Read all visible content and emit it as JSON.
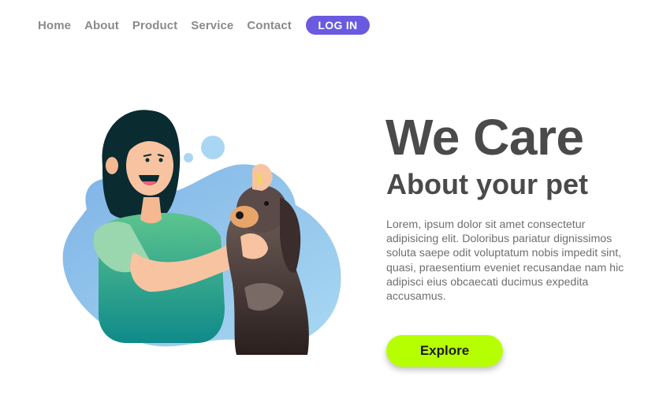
{
  "nav": {
    "items": [
      {
        "label": "Home"
      },
      {
        "label": "About"
      },
      {
        "label": "Product"
      },
      {
        "label": "Service"
      },
      {
        "label": "Contact"
      }
    ],
    "login_label": "LOG IN"
  },
  "hero": {
    "title": "We Care",
    "subtitle": "About your pet",
    "body": "Lorem, ipsum dolor sit amet consectetur adipisicing elit. Doloribus pariatur dignissimos soluta saepe odit voluptatum nobis impedit sint, quasi, praesentium eveniet recusandae nam hic adipisci eius obcaecati ducimus expedita accusamus.",
    "cta_label": "Explore"
  },
  "colors": {
    "accent": "#6a5ae0",
    "cta": "#b6ff00",
    "text_dark": "#4a4a4a",
    "text_muted": "#8a8a8a",
    "blob_blue": "#8ec6ec"
  },
  "illustration": {
    "icon": "woman-giving-dog-eye-drops-illustration"
  }
}
